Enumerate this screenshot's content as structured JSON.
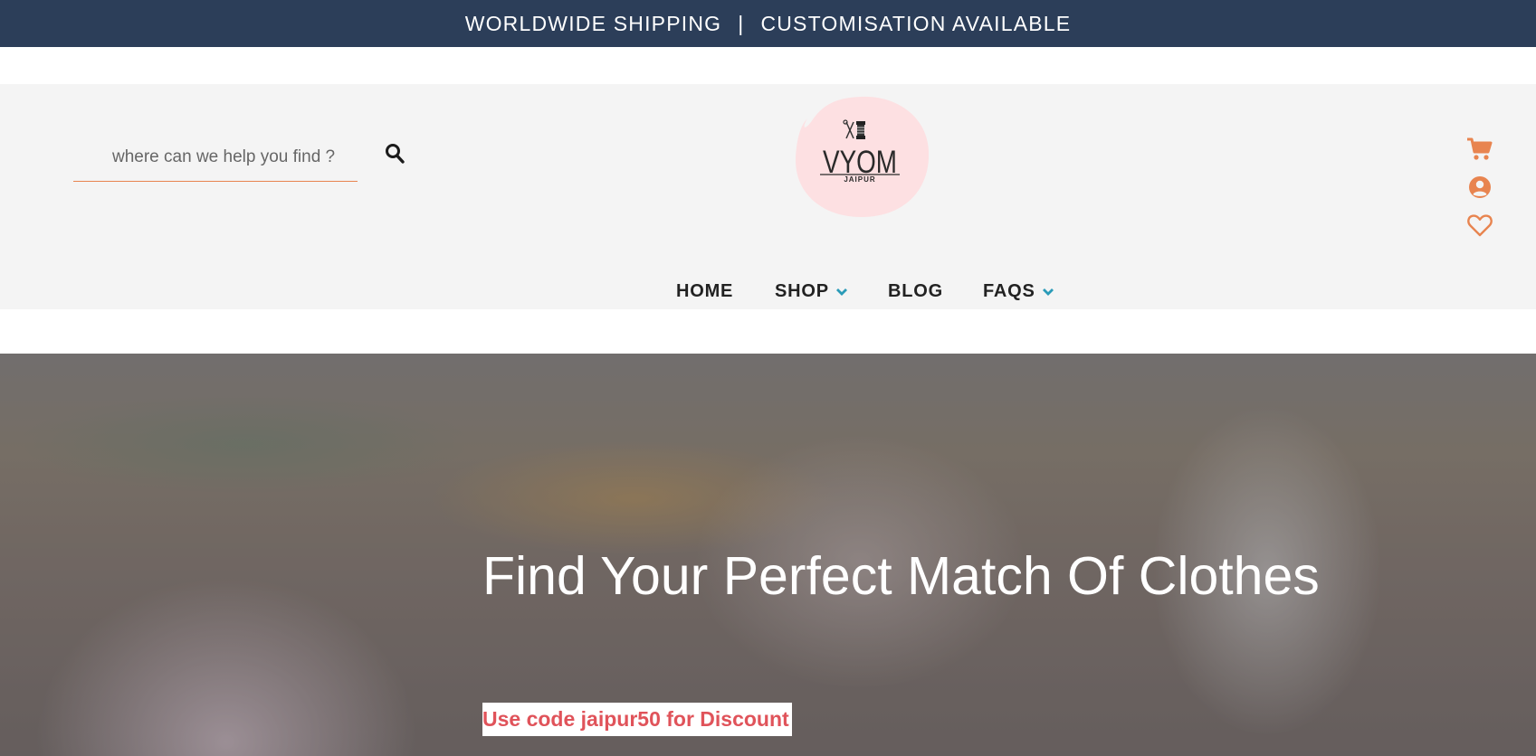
{
  "announcement": {
    "left": "WORLDWIDE SHIPPING",
    "separator": "|",
    "right": "CUSTOMISATION AVAILABLE"
  },
  "search": {
    "placeholder": "where can we help you find ?",
    "button_icon": "search-icon"
  },
  "logo": {
    "brand": "VYOM",
    "city": "JAIPUR",
    "icon": "needle-thread-spool-icon"
  },
  "header_icons": [
    {
      "name": "cart-icon"
    },
    {
      "name": "user-icon"
    },
    {
      "name": "heart-icon"
    }
  ],
  "nav": {
    "home": "HOME",
    "shop": "SHOP",
    "blog": "BLOG",
    "faqs": "FAQS"
  },
  "hero": {
    "title": "Find Your Perfect Match Of Clothes",
    "promo": "Use code jaipur50 for Discount"
  },
  "colors": {
    "topbar": "#2c3e59",
    "accent": "#e8844f",
    "chevron": "#2a9bb8",
    "promo_text": "#e0535a",
    "logo_bg": "#fde0e2"
  }
}
